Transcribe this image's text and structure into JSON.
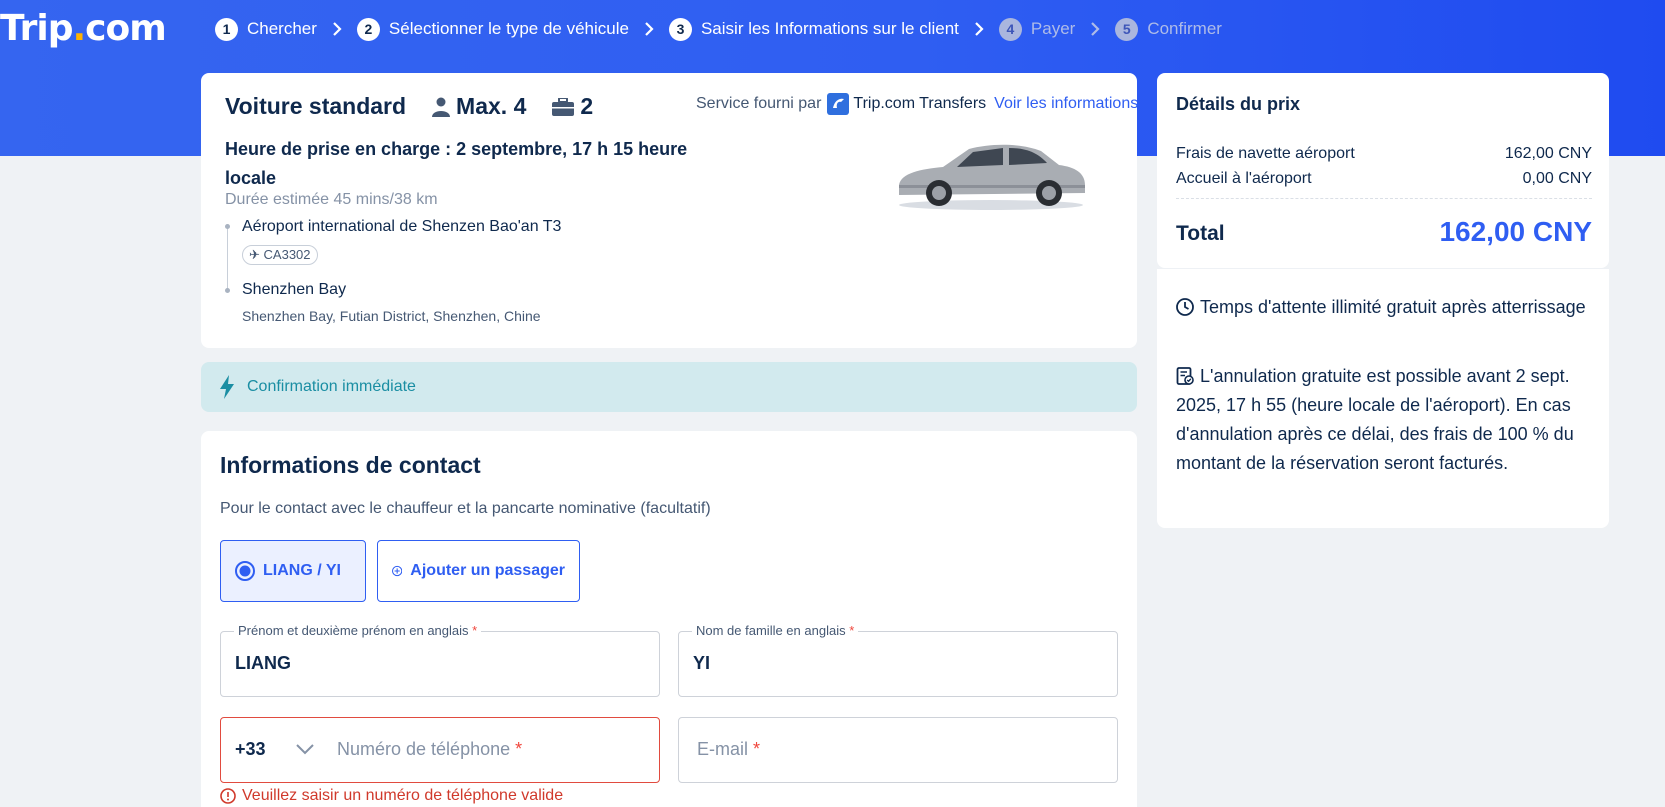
{
  "brand": {
    "name_part1": "Trip",
    "dot": ".",
    "name_part2": "com"
  },
  "steps": [
    {
      "num": "1",
      "label": "Chercher"
    },
    {
      "num": "2",
      "label": "Sélectionner le type de véhicule"
    },
    {
      "num": "3",
      "label": "Saisir les Informations sur le client"
    },
    {
      "num": "4",
      "label": "Payer"
    },
    {
      "num": "5",
      "label": "Confirmer"
    }
  ],
  "vehicle": {
    "title": "Voiture standard",
    "max_passengers": "Max. 4",
    "luggage": "2",
    "service_prefix": "Service fourni par",
    "provider": "Trip.com Transfers",
    "info_link": "Voir les informations",
    "pickup": "Heure de prise en charge : 2 septembre, 17 h 15 heure locale",
    "duration": "Durée estimée 45 mins/38 km",
    "from": "Aéroport international de Shenzen Bao'an T3",
    "flight": "CA3302",
    "to": "Shenzhen Bay",
    "to_address": "Shenzhen Bay, Futian District, Shenzhen, Chine"
  },
  "confirmation": "Confirmation immédiate",
  "contact": {
    "title": "Informations de contact",
    "subtitle": "Pour le contact avec le chauffeur et la pancarte nominative (facultatif)",
    "selected_passenger": "LIANG / YI",
    "add_passenger": "Ajouter un passager",
    "first_name_label": "Prénom et deuxième prénom en anglais",
    "first_name_value": "LIANG",
    "last_name_label": "Nom de famille en anglais",
    "last_name_value": "YI",
    "required_mark": "*",
    "country_code": "+33",
    "phone_placeholder": "Numéro de téléphone",
    "email_placeholder": "E-mail",
    "phone_error": "Veuillez saisir un numéro de téléphone valide"
  },
  "price": {
    "title": "Détails du prix",
    "rows": [
      {
        "label": "Frais de navette aéroport",
        "value": "162,00 CNY"
      },
      {
        "label": "Accueil à l'aéroport",
        "value": "0,00 CNY"
      }
    ],
    "total_label": "Total",
    "total_value": "162,00 CNY"
  },
  "policy": {
    "waiting": "Temps d'attente illimité gratuit après atterrissage",
    "cancellation": "L'annulation gratuite est possible avant 2 sept. 2025, 17 h 55 (heure locale de l'aéroport). En cas d'annulation après ce délai, des frais de 100 % du montant de la réservation seront facturés."
  },
  "colors": {
    "accent": "#2f5ef2",
    "error": "#d0392b",
    "confirm_bg": "#d2eaee",
    "confirm_text": "#1a8ea3"
  }
}
